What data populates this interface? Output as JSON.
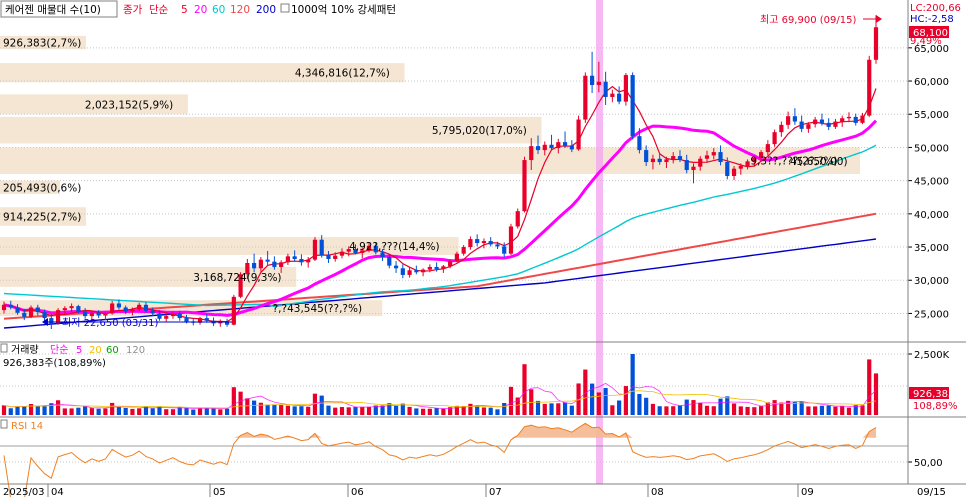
{
  "header": {
    "stock_name": "케어젠 매물대 수(10)",
    "price_label": "종가",
    "ma_label": "단순",
    "ma_periods": [
      "5",
      "20",
      "60",
      "120",
      "200"
    ],
    "ma_colors": [
      "#e8002a",
      "#ff00ff",
      "#00c8d0",
      "#f04848",
      "#0000c8"
    ],
    "pattern_label": "1000억 10% 강세패턴"
  },
  "indicators": {
    "lc": "LC:200,66",
    "hc": "HC:-2,58"
  },
  "annotations": {
    "high_label": "최고 69,900 (09/15)",
    "low_label": "최저 22,650 (03/31)",
    "pct_label": "9,49%",
    "current_price": "68,100",
    "range_label": "45,650,00)"
  },
  "volume_panel": {
    "title": "거래량",
    "ma_label": "단순",
    "ma_periods": [
      "5",
      "20",
      "60",
      "120"
    ],
    "ma_colors": [
      "#ff00ff",
      "#f0c000",
      "#00a000",
      "#909090"
    ],
    "value_label": "926,383주(108,89%)",
    "badge_value": "926,383",
    "badge_pct": "108,89%",
    "axis_label": "2,500K"
  },
  "rsi_panel": {
    "title": "RSI 14",
    "axis_label": "50,00"
  },
  "chart_data": {
    "type": "candlestick",
    "title": "케어젠 매물대 수(10)",
    "y_ticks": [
      "65,000",
      "60,000",
      "55,000",
      "50,000",
      "45,000",
      "40,000",
      "35,000",
      "30,000",
      "25,000"
    ],
    "x_ticks": [
      "2025/03",
      "04",
      "05",
      "06",
      "07",
      "08",
      "09",
      "09/15"
    ],
    "ylim": [
      21000,
      71000
    ],
    "volume_profile": [
      {
        "price_low": 64800,
        "price_high": 66800,
        "label": "926,383(2,7%)",
        "pct": 2.7
      },
      {
        "price_low": 59800,
        "price_high": 62700,
        "label": "4,346,816(12,7%)",
        "pct": 12.7
      },
      {
        "price_low": 55000,
        "price_high": 58000,
        "label": "2,023,152(5,9%)",
        "pct": 5.9
      },
      {
        "price_low": 50600,
        "price_high": 54600,
        "label": "5,795,020(17,0%)",
        "pct": 17.0
      },
      {
        "price_low": 46000,
        "price_high": 50000,
        "label": "9,3??,???(2?,?%)",
        "pct": 27.0
      },
      {
        "price_low": 43000,
        "price_high": 45000,
        "label": "205,493(0,6%)",
        "pct": 0.6
      },
      {
        "price_low": 38200,
        "price_high": 41000,
        "label": "914,225(2,7%)",
        "pct": 2.7
      },
      {
        "price_low": 33800,
        "price_high": 36500,
        "label": "4,92?,???(14,4%)",
        "pct": 14.4
      },
      {
        "price_low": 29000,
        "price_high": 32000,
        "label": "3,168,724(9,3%)",
        "pct": 9.3
      },
      {
        "price_low": 24600,
        "price_high": 27000,
        "label": "?,?43,545(??,?%)",
        "pct": 12.0
      }
    ],
    "candles": [
      [
        25500,
        26800,
        25000,
        26300
      ],
      [
        26300,
        26900,
        25600,
        25900
      ],
      [
        25900,
        26400,
        24800,
        25100
      ],
      [
        25100,
        25700,
        24000,
        24500
      ],
      [
        24500,
        26200,
        24300,
        25900
      ],
      [
        25900,
        26300,
        24700,
        25200
      ],
      [
        25200,
        25600,
        23900,
        24300
      ],
      [
        24300,
        24900,
        22650,
        23500
      ],
      [
        23500,
        25800,
        23300,
        25500
      ],
      [
        25500,
        26100,
        24800,
        25800
      ],
      [
        25800,
        26500,
        25200,
        26100
      ],
      [
        26100,
        26300,
        25000,
        25300
      ],
      [
        25300,
        25800,
        24200,
        24600
      ],
      [
        24600,
        25400,
        24100,
        25100
      ],
      [
        25100,
        25500,
        24300,
        24700
      ],
      [
        24700,
        25300,
        24000,
        25000
      ],
      [
        25000,
        26900,
        24800,
        26500
      ],
      [
        26500,
        27100,
        25600,
        25900
      ],
      [
        25900,
        26200,
        24900,
        25300
      ],
      [
        25300,
        25900,
        24700,
        25600
      ],
      [
        25600,
        26600,
        25400,
        26300
      ],
      [
        26300,
        26700,
        25100,
        25400
      ],
      [
        25400,
        25900,
        24600,
        25000
      ],
      [
        25000,
        25500,
        23900,
        24200
      ],
      [
        24200,
        24900,
        23800,
        24600
      ],
      [
        24600,
        25300,
        24200,
        25000
      ],
      [
        25000,
        25400,
        23900,
        24300
      ],
      [
        24300,
        24800,
        23500,
        23800
      ],
      [
        23800,
        24300,
        23200,
        23600
      ],
      [
        23600,
        24500,
        23300,
        24300
      ],
      [
        24300,
        24900,
        23600,
        23900
      ],
      [
        23900,
        24400,
        23100,
        23500
      ],
      [
        23500,
        24100,
        23000,
        23800
      ],
      [
        23800,
        24200,
        23000,
        23300
      ],
      [
        23300,
        27800,
        23200,
        27500
      ],
      [
        27500,
        31200,
        27300,
        30900
      ],
      [
        30900,
        33200,
        30200,
        32600
      ],
      [
        32600,
        34000,
        31200,
        31800
      ],
      [
        31800,
        33500,
        31300,
        33100
      ],
      [
        33100,
        34400,
        32300,
        32800
      ],
      [
        32800,
        33600,
        31600,
        32000
      ],
      [
        32000,
        33000,
        31100,
        32700
      ],
      [
        32700,
        34000,
        32300,
        33600
      ],
      [
        33600,
        34500,
        32800,
        33200
      ],
      [
        33200,
        33900,
        32200,
        32700
      ],
      [
        32700,
        33500,
        31900,
        33100
      ],
      [
        33100,
        36500,
        32900,
        36100
      ],
      [
        36100,
        36800,
        33400,
        33800
      ],
      [
        33800,
        34400,
        32600,
        33200
      ],
      [
        33200,
        34200,
        32800,
        33700
      ],
      [
        33700,
        34800,
        33300,
        34300
      ],
      [
        34300,
        35100,
        33600,
        34700
      ],
      [
        34700,
        35400,
        33900,
        34100
      ],
      [
        34100,
        34900,
        33300,
        34500
      ],
      [
        34500,
        35700,
        34200,
        35200
      ],
      [
        35200,
        35600,
        33900,
        34200
      ],
      [
        34200,
        34700,
        32900,
        33500
      ],
      [
        33500,
        33900,
        31800,
        32200
      ],
      [
        32200,
        32900,
        31100,
        31800
      ],
      [
        31800,
        32400,
        30300,
        30800
      ],
      [
        30800,
        31900,
        30400,
        31500
      ],
      [
        31500,
        32200,
        30900,
        31200
      ],
      [
        31200,
        31800,
        30600,
        31600
      ],
      [
        31600,
        32400,
        31200,
        32000
      ],
      [
        32000,
        32700,
        31300,
        31700
      ],
      [
        31700,
        32300,
        31100,
        32100
      ],
      [
        32100,
        33200,
        31800,
        32900
      ],
      [
        32900,
        34300,
        32700,
        34000
      ],
      [
        34000,
        35300,
        33700,
        35000
      ],
      [
        35000,
        36600,
        34600,
        36200
      ],
      [
        36200,
        36900,
        35100,
        35600
      ],
      [
        35600,
        36300,
        34800,
        35900
      ],
      [
        35900,
        36500,
        35100,
        35400
      ],
      [
        35400,
        35800,
        34700,
        35100
      ],
      [
        35100,
        35700,
        33500,
        34000
      ],
      [
        34000,
        38500,
        33800,
        38100
      ],
      [
        38100,
        40800,
        37800,
        40400
      ],
      [
        40400,
        48600,
        40200,
        48100
      ],
      [
        48100,
        51400,
        46600,
        50200
      ],
      [
        50200,
        51800,
        49000,
        49600
      ],
      [
        49600,
        50900,
        48800,
        50400
      ],
      [
        50400,
        51900,
        49600,
        49900
      ],
      [
        49900,
        51300,
        49100,
        50800
      ],
      [
        50800,
        52400,
        49900,
        50300
      ],
      [
        50300,
        51100,
        49300,
        49700
      ],
      [
        49700,
        54800,
        49500,
        54200
      ],
      [
        54200,
        61300,
        53700,
        60800
      ],
      [
        60800,
        64400,
        58200,
        59400
      ],
      [
        59400,
        62900,
        58300,
        59900
      ],
      [
        59900,
        61400,
        56400,
        57600
      ],
      [
        57600,
        58700,
        56800,
        58100
      ],
      [
        58100,
        59200,
        56500,
        56900
      ],
      [
        56900,
        61200,
        56300,
        60900
      ],
      [
        60900,
        61300,
        51200,
        51700
      ],
      [
        51700,
        52900,
        49100,
        49600
      ],
      [
        49600,
        50300,
        47200,
        47800
      ],
      [
        47800,
        48900,
        46700,
        48300
      ],
      [
        48300,
        49100,
        47400,
        47800
      ],
      [
        47800,
        48600,
        46900,
        48200
      ],
      [
        48200,
        49300,
        47600,
        48700
      ],
      [
        48700,
        49600,
        47800,
        48100
      ],
      [
        48100,
        48900,
        46100,
        46600
      ],
      [
        46600,
        47600,
        44600,
        47100
      ],
      [
        47100,
        48700,
        46500,
        48300
      ],
      [
        48300,
        49500,
        47700,
        48800
      ],
      [
        48800,
        49900,
        48200,
        49300
      ],
      [
        49300,
        50300,
        47300,
        47800
      ],
      [
        47800,
        48500,
        45200,
        45700
      ],
      [
        45700,
        47200,
        45100,
        46800
      ],
      [
        46800,
        47600,
        45900,
        47200
      ],
      [
        47200,
        48200,
        46700,
        47900
      ],
      [
        47900,
        48600,
        47100,
        48400
      ],
      [
        48400,
        49600,
        48000,
        49300
      ],
      [
        49300,
        51100,
        48800,
        50500
      ],
      [
        50500,
        52700,
        50100,
        52300
      ],
      [
        52300,
        53900,
        51600,
        53400
      ],
      [
        53400,
        55400,
        52800,
        54700
      ],
      [
        54700,
        55900,
        53400,
        53900
      ],
      [
        53900,
        54800,
        52300,
        52800
      ],
      [
        52800,
        53800,
        52200,
        53500
      ],
      [
        53500,
        54600,
        53000,
        54200
      ],
      [
        54200,
        55100,
        53300,
        53700
      ],
      [
        53700,
        54400,
        52600,
        53100
      ],
      [
        53100,
        54300,
        52800,
        53900
      ],
      [
        53900,
        54800,
        53100,
        54400
      ],
      [
        54400,
        55300,
        53800,
        54600
      ],
      [
        54600,
        55100,
        53300,
        53700
      ],
      [
        53700,
        55200,
        53500,
        54800
      ],
      [
        54800,
        63800,
        54600,
        63200
      ],
      [
        63200,
        69900,
        62600,
        68100
      ]
    ],
    "rsi_last": 65.0
  }
}
